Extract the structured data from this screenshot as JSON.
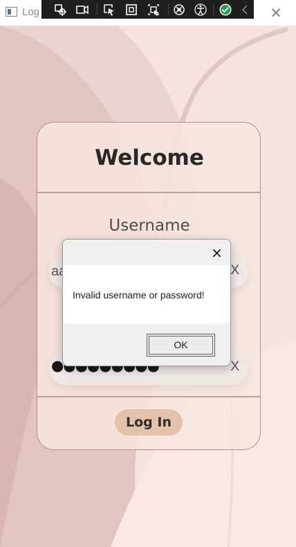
{
  "window": {
    "title": "Log",
    "close_glyph": "×"
  },
  "toolbar": {
    "tools": [
      {
        "name": "select-element-icon"
      },
      {
        "name": "video-icon"
      },
      {
        "name": "pointer-icon"
      },
      {
        "name": "layout-box-icon"
      },
      {
        "name": "select-region-icon"
      },
      {
        "name": "theme-icon"
      },
      {
        "name": "accessibility-icon"
      },
      {
        "name": "check-circle-icon"
      },
      {
        "name": "chevron-left-icon"
      }
    ]
  },
  "login": {
    "title": "Welcome",
    "username_label": "Username",
    "username_value": "aa",
    "clear_label": "X",
    "password_mask": "●●●●●●●●●",
    "login_button": "Log In"
  },
  "dialog": {
    "message": "Invalid username or password!",
    "ok_label": "OK",
    "close_glyph": "×"
  },
  "colors": {
    "background": "#f3e1dd",
    "card": "#f7e6de",
    "button": "#e2c2a8",
    "toolbar": "#1f1f1f",
    "success": "#16a34a"
  }
}
